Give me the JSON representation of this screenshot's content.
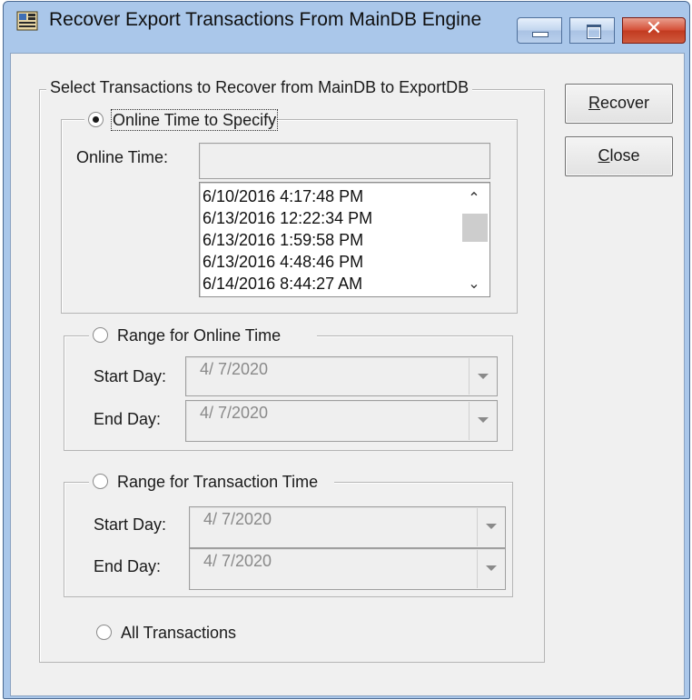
{
  "window": {
    "title": "Recover Export Transactions From MainDB Engine",
    "icon": "app-icon",
    "controls": {
      "minimize": "minimize-icon",
      "maximize": "maximize-icon",
      "close": "close-icon"
    }
  },
  "main_group": {
    "legend": "Select Transactions to Recover from MainDB to ExportDB"
  },
  "online_specify": {
    "label": "Online Time to Specify",
    "selected": true,
    "field_label": "Online  Time:",
    "field_value": "",
    "list": [
      "6/10/2016 4:17:48 PM",
      "6/13/2016 12:22:34 PM",
      "6/13/2016 1:59:58 PM",
      "6/13/2016 4:48:46 PM",
      "6/14/2016 8:44:27 AM"
    ]
  },
  "range_online": {
    "label": "Range for Online Time",
    "selected": false,
    "start_label": "Start Day:",
    "start_value": "4/  7/2020",
    "end_label": "End Day:",
    "end_value": "4/  7/2020"
  },
  "range_transaction": {
    "label": "Range for Transaction Time",
    "selected": false,
    "start_label": "Start Day:",
    "start_value": "4/  7/2020",
    "end_label": "End Day:",
    "end_value": "4/  7/2020"
  },
  "all_transactions": {
    "label": "All Transactions",
    "selected": false
  },
  "buttons": {
    "recover": {
      "mnemonic": "R",
      "rest": "ecover"
    },
    "close": {
      "mnemonic": "C",
      "rest": "lose"
    }
  },
  "colors": {
    "titlebar": "#aac7ea",
    "client": "#f0f0f0",
    "close_button": "#c23a20"
  }
}
